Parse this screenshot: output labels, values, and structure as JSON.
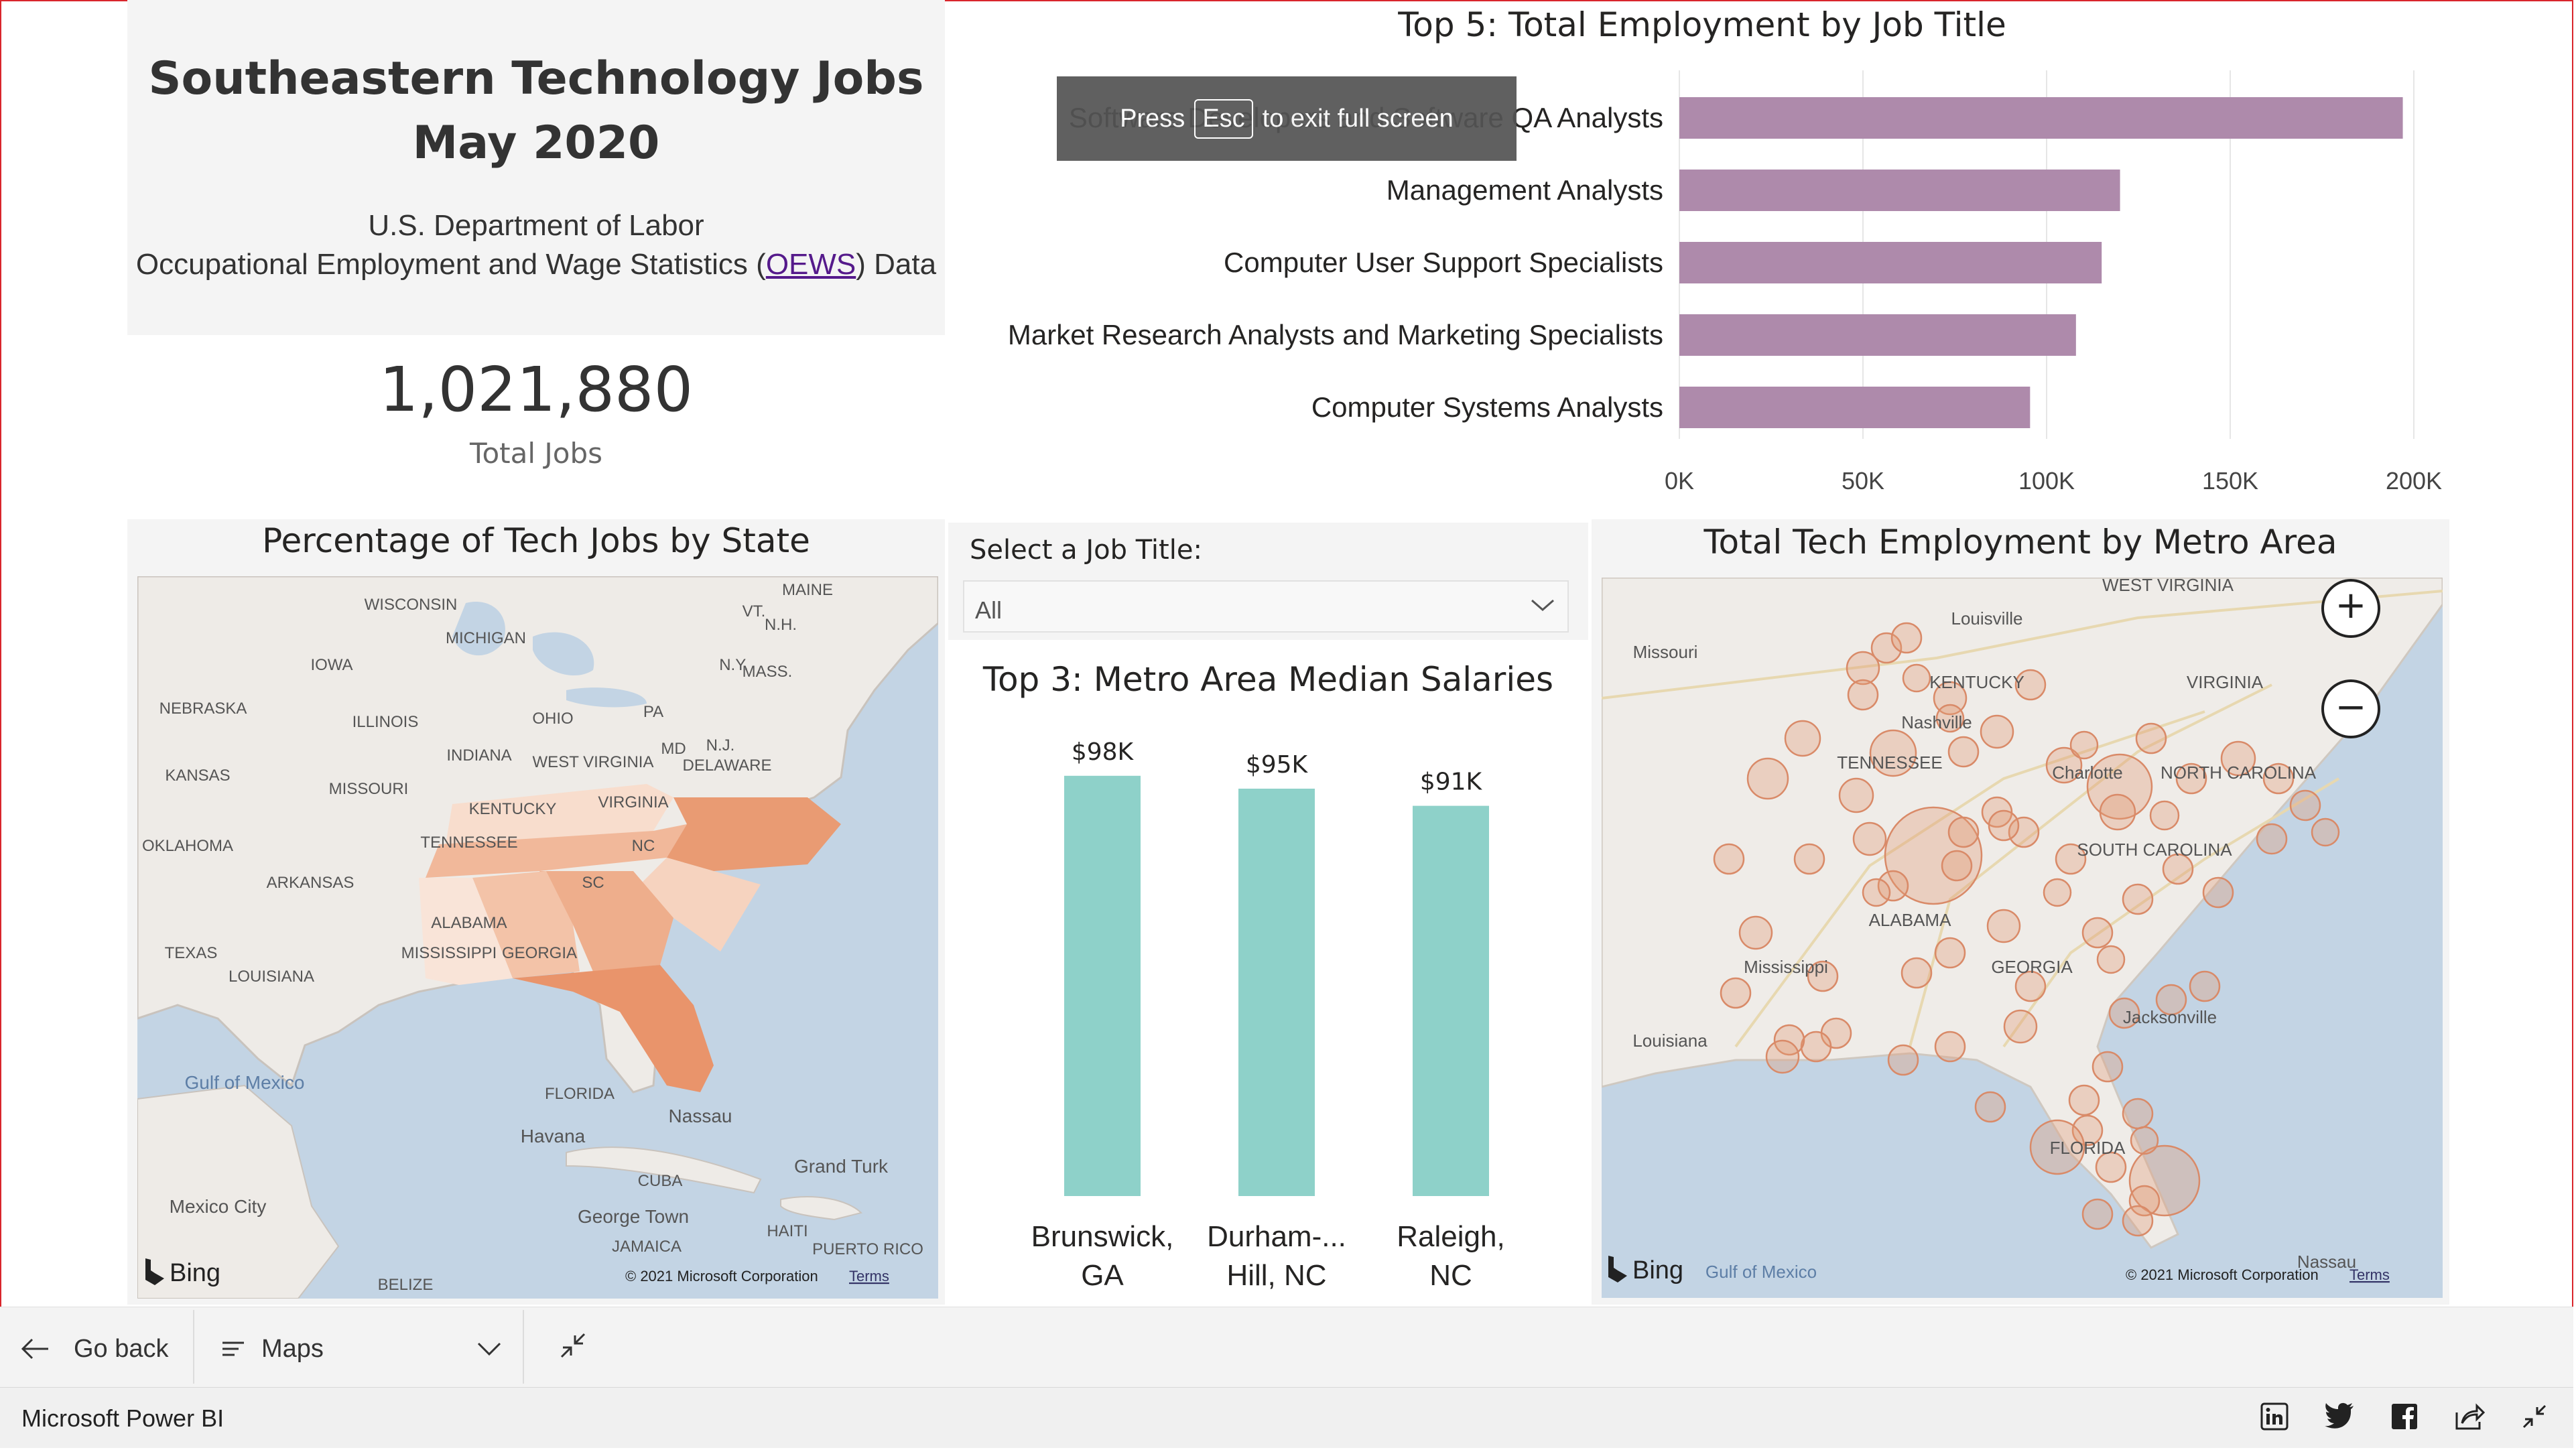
{
  "report": {
    "title_line1": "Southeastern Technology Jobs",
    "title_line2": "May 2020",
    "source_line1": "U.S. Department of Labor",
    "source_line2_prefix": "Occupational Employment and Wage Statistics (",
    "source_link": "OEWS",
    "source_line2_suffix": ") Data"
  },
  "kpi": {
    "value": "1,021,880",
    "label": "Total Jobs"
  },
  "fullscreen_hint": {
    "press": "Press",
    "key": "Esc",
    "suffix": "to exit full screen"
  },
  "top5_chart": {
    "title": "Top 5: Total Employment by Job Title",
    "chart_data": {
      "type": "bar",
      "orientation": "horizontal",
      "categories": [
        "Software Developers and Software QA Analysts",
        "Management Analysts",
        "Computer User Support Specialists",
        "Market Research Analysts and Marketing Specialists",
        "Computer Systems Analysts"
      ],
      "values": [
        197000,
        120000,
        115000,
        108000,
        95500
      ],
      "xlim": [
        0,
        200000
      ],
      "ticks": [
        "0K",
        "50K",
        "100K",
        "150K",
        "200K"
      ],
      "tick_values": [
        0,
        50000,
        100000,
        150000,
        200000
      ],
      "grid": true,
      "color": "#ae8aab"
    }
  },
  "state_map": {
    "title": "Percentage of Tech Jobs by State",
    "labels": [
      "WISCONSIN",
      "MICHIGAN",
      "MAINE",
      "VT.",
      "N.H.",
      "IOWA",
      "N.Y.",
      "MASS.",
      "NEBRASKA",
      "ILLINOIS",
      "OHIO",
      "PA",
      "INDIANA",
      "WEST VIRGINIA",
      "MD",
      "N.J.",
      "DELAWARE",
      "KANSAS",
      "MISSOURI",
      "KENTUCKY",
      "VIRGINIA",
      "OKLAHOMA",
      "TENNESSEE",
      "NC",
      "ARKANSAS",
      "SC",
      "ALABAMA",
      "TEXAS",
      "MISSISSIPPI",
      "GEORGIA",
      "LOUISIANA",
      "FLORIDA",
      "Gulf of Mexico",
      "Nassau",
      "Havana",
      "CUBA",
      "Grand Turk",
      "Mexico City",
      "George Town",
      "JAMAICA",
      "HAITI",
      "PUERTO RICO",
      "BELIZE"
    ],
    "bing": "Bing",
    "copyright": "© 2021 Microsoft Corporation",
    "terms": "Terms",
    "colors": {
      "water": "#c3d4e4",
      "land": "#efecea",
      "high": "#e9946b",
      "mid": "#f0b08f",
      "low": "#f6d3bf",
      "lowest": "#f9e4d8"
    }
  },
  "slicer": {
    "label": "Select a Job Title:",
    "value": "All"
  },
  "salary_chart": {
    "title": "Top 3: Metro Area Median Salaries",
    "chart_data": {
      "type": "bar",
      "categories": [
        "Brunswick, GA",
        "Durham-... Hill, NC",
        "Raleigh, NC"
      ],
      "category_lines": [
        [
          "Brunswick,",
          "GA"
        ],
        [
          "Durham-...",
          "Hill, NC"
        ],
        [
          "Raleigh,",
          "NC"
        ]
      ],
      "values": [
        98,
        95,
        91
      ],
      "data_labels": [
        "$98K",
        "$95K",
        "$91K"
      ],
      "unit": "thousand USD",
      "color": "#8ed1c9"
    }
  },
  "metro_map": {
    "title": "Total Tech Employment by Metro Area",
    "labels": [
      "WEST VIRGINIA",
      "Louisville",
      "Missouri",
      "KENTUCKY",
      "VIRGINIA",
      "Nashville",
      "TENNESSEE",
      "Charlotte",
      "NORTH CAROLINA",
      "SOUTH CAROLINA",
      "ALABAMA",
      "Mississippi",
      "GEORGIA",
      "Louisiana",
      "Jacksonville",
      "FLORIDA",
      "Gulf of Mexico",
      "Nassau"
    ],
    "zoom_in": "+",
    "zoom_out": "−",
    "bing": "Bing",
    "copyright": "© 2021 Microsoft Corporation",
    "terms": "Terms",
    "bubble_color": "#e39a76"
  },
  "nav": {
    "go_back": "Go back",
    "page": "Maps"
  },
  "status": {
    "app_name": "Microsoft Power BI"
  }
}
